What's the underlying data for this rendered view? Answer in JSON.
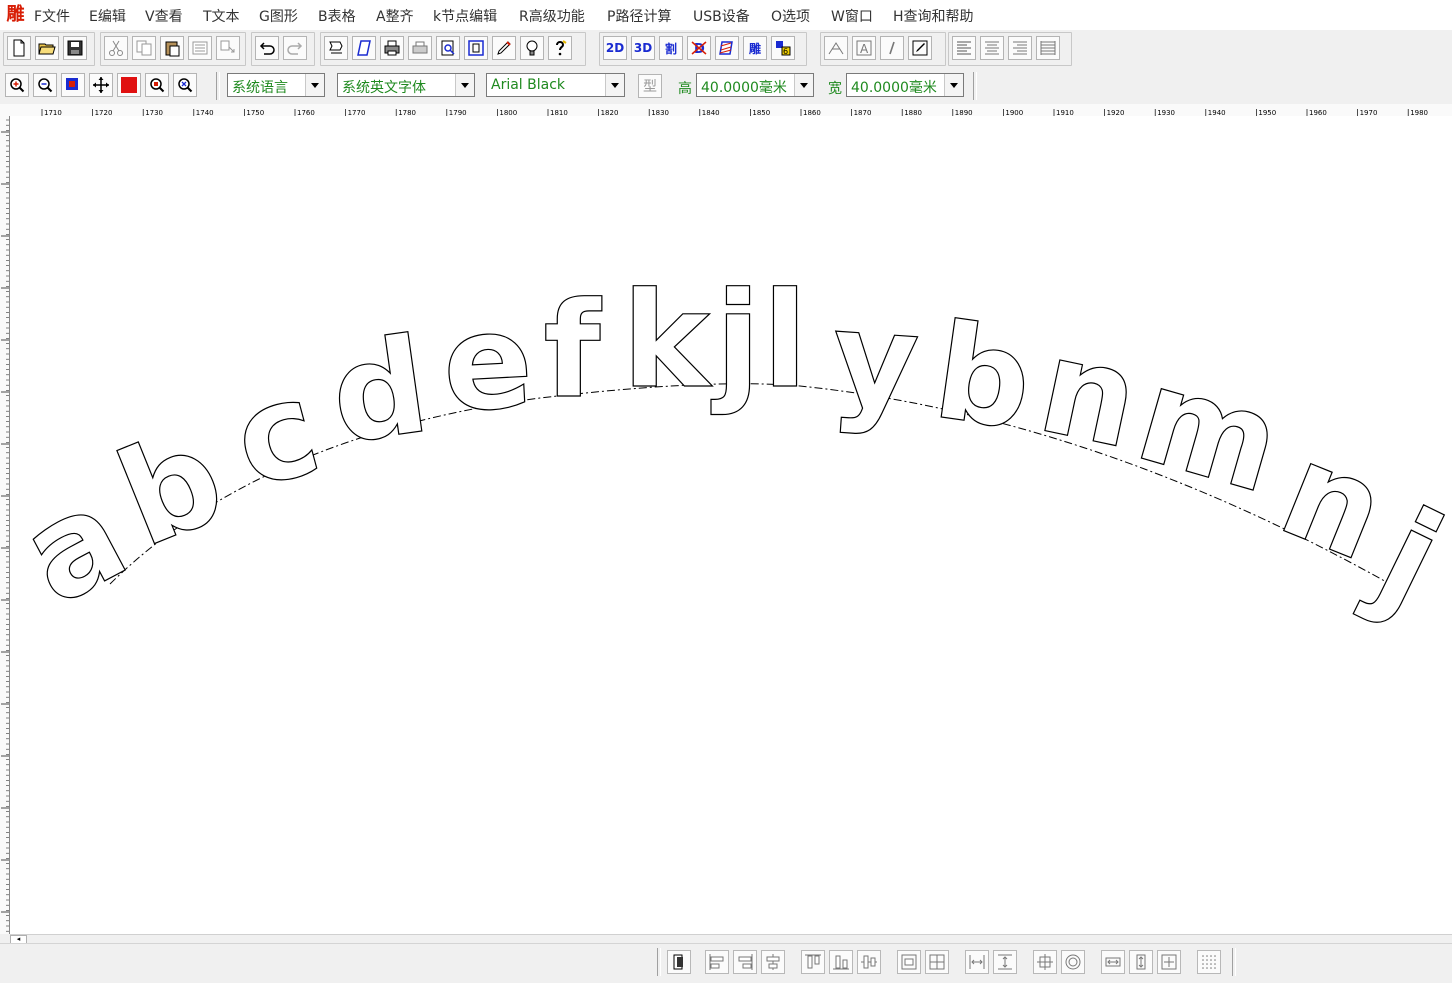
{
  "app": {
    "logo_glyph": "雕"
  },
  "menu": [
    "F文件",
    "E编辑",
    "V查看",
    "T文本",
    "G图形",
    "B表格",
    "A整齐",
    "k节点编辑",
    "R高级功能",
    "P路径计算",
    "USB设备",
    "O选项",
    "W窗口",
    "H查询和帮助"
  ],
  "toolbar1": {
    "text_buttons": {
      "2d": "2D",
      "3d": "3D",
      "cut": "割",
      "engrave": "雕"
    }
  },
  "toolbar2": {
    "language": "系统语言",
    "font_family_cn": "系统英文字体",
    "font_family_en": "Arial Black",
    "type_label": "型",
    "height_label": "高",
    "height_value": "40.0000毫米",
    "width_label": "宽",
    "width_value": "40.0000毫米"
  },
  "ruler": {
    "labels": [
      "1710",
      "1720",
      "1730",
      "1740",
      "1750",
      "1760",
      "1770",
      "1780",
      "1790",
      "1800",
      "1810",
      "1820",
      "1830",
      "1840",
      "1850",
      "1860",
      "1870",
      "1880",
      "1890",
      "1900",
      "1910",
      "1920",
      "1930",
      "1940",
      "1950",
      "1960",
      "1970",
      "1980"
    ]
  },
  "canvas": {
    "arc_text": "abcdefkjlybnmnj",
    "letters": [
      "a",
      "b",
      "c",
      "d",
      "e",
      "f",
      "k",
      "j",
      "l",
      "y",
      "b",
      "n",
      "m",
      "n",
      "j"
    ]
  },
  "colors": {
    "accent_blue": "#1a2bd1",
    "combo_text": "#1f8a1f",
    "logo_red": "#d81e06"
  }
}
